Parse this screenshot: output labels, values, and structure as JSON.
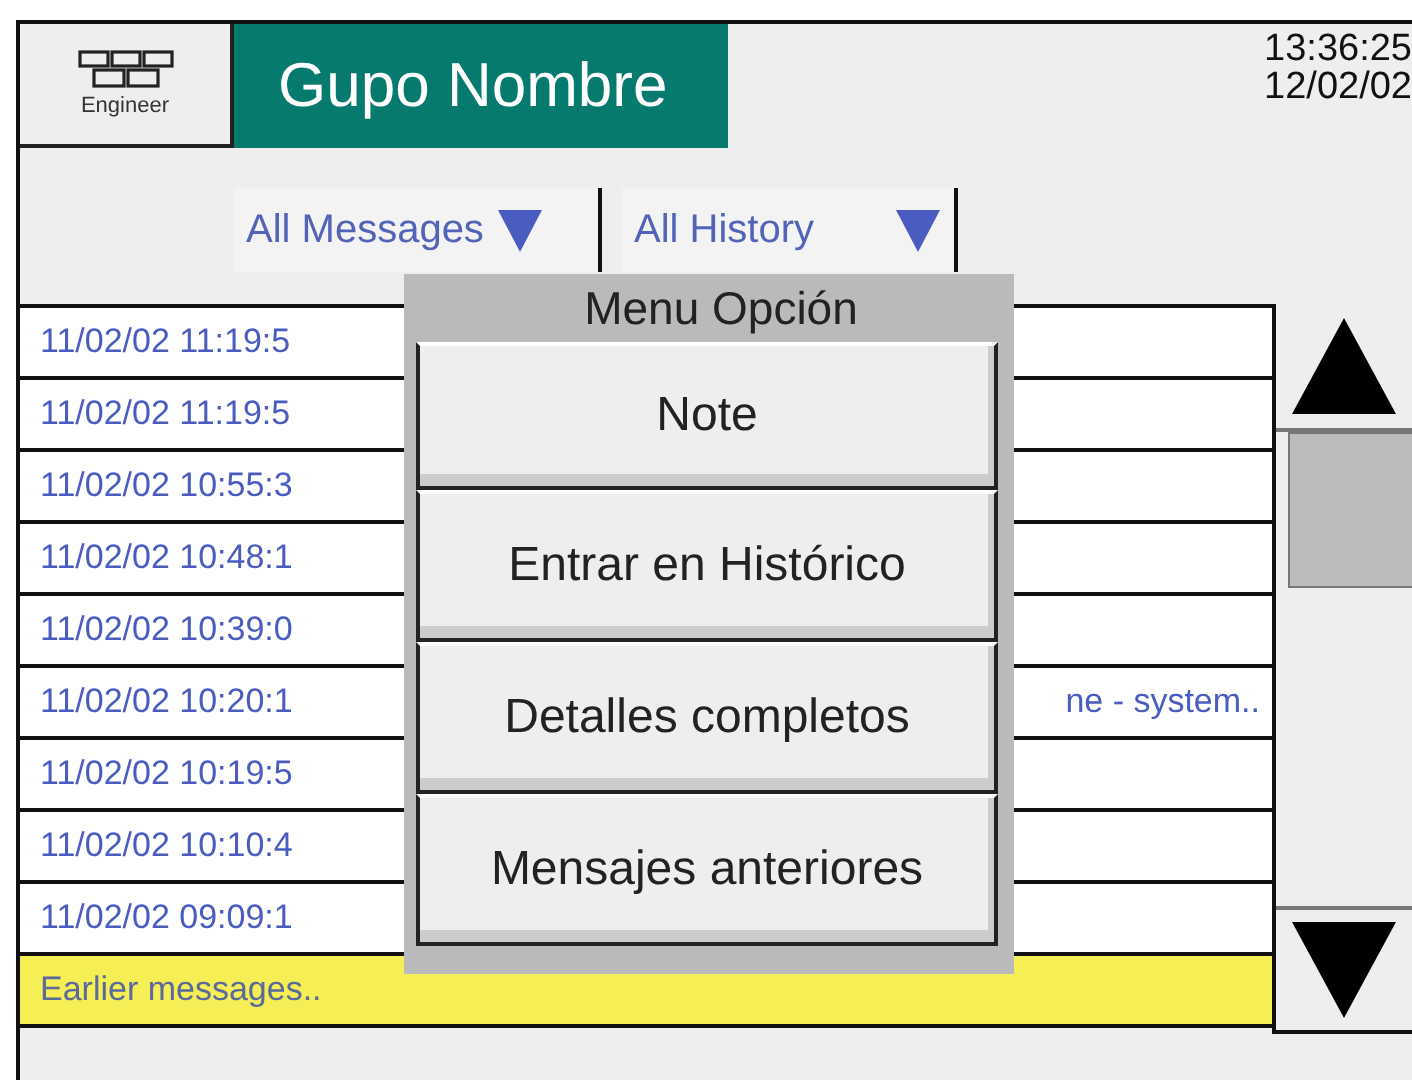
{
  "header": {
    "user": "Engineer",
    "title": "Gupo Nombre",
    "time": "13:36:25",
    "date": "12/02/02"
  },
  "filters": [
    {
      "label": "All Messages"
    },
    {
      "label": "All History"
    }
  ],
  "messages": [
    {
      "time": "11/02/02 11:19:5"
    },
    {
      "time": "11/02/02 11:19:5"
    },
    {
      "time": "11/02/02 10:55:3"
    },
    {
      "time": "11/02/02 10:48:1"
    },
    {
      "time": "11/02/02 10:39:0"
    },
    {
      "time": "11/02/02 10:20:1",
      "text": "ne - system.."
    },
    {
      "time": "11/02/02 10:19:5"
    },
    {
      "time": "11/02/02 10:10:4"
    },
    {
      "time": "11/02/02 09:09:1"
    }
  ],
  "footer": "Earlier messages..",
  "menu": {
    "title": "Menu Opción",
    "items": [
      "Note",
      "Entrar en Histórico",
      "Detalles completos",
      "Mensajes anteriores"
    ]
  }
}
